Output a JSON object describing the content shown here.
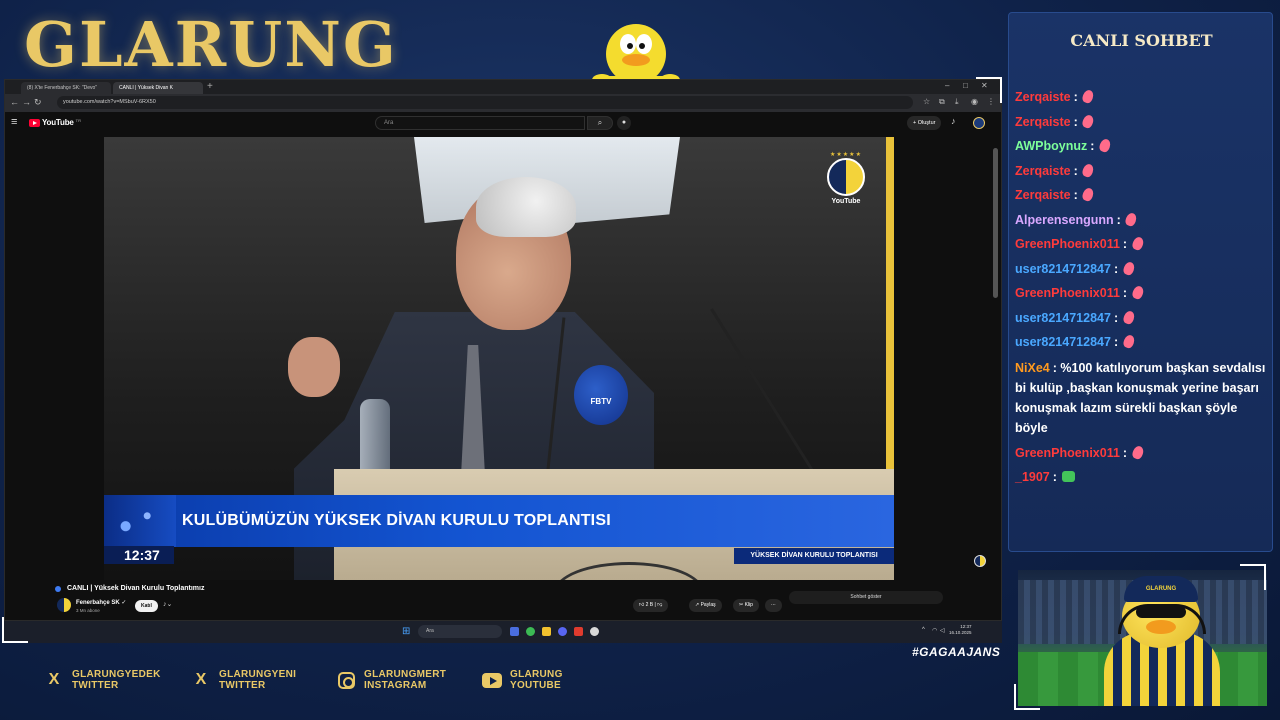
{
  "brand": {
    "name": "GLARUNG"
  },
  "browser": {
    "tabs": [
      {
        "label": "(8) X'te Fenerbahçe SK: \"Devo\""
      },
      {
        "label": "CANLI | Yüksek Divan K"
      }
    ],
    "url": "youtube.com/watch?v=MSbuV-6RX50"
  },
  "youtube": {
    "logo_text": "YouTube",
    "region": "TR",
    "search_placeholder": "Ara",
    "create_label": "Oluştur",
    "video": {
      "badge_text": "YouTube",
      "mic_label": "FBTV",
      "lower_third_title": "KULÜBÜMÜZÜN YÜKSEK DİVAN KURULU TOPLANTISI",
      "lower_third_time": "12:37",
      "lower_third_sub": "YÜKSEK DİVAN KURULU TOPLANTISI"
    },
    "title": "CANLI | Yüksek Divan Kurulu Toplantımız",
    "channel_name": "Fenerbahçe SK",
    "channel_subs": "3 Mn abone",
    "join_label": "Katıl",
    "likes": "2 B",
    "share_label": "Paylaş",
    "clip_label": "Klip",
    "show_chat_label": "Sohbet göster"
  },
  "taskbar": {
    "search_placeholder": "Ara",
    "time": "12:37",
    "date": "16.10.2025"
  },
  "chat": {
    "header": "CANLI SOHBET",
    "messages": [
      {
        "user": "Zerqaiste",
        "color": "#ff3b3b",
        "text": "",
        "emote": "pink"
      },
      {
        "user": "Zerqaiste",
        "color": "#ff3b3b",
        "text": "",
        "emote": "pink"
      },
      {
        "user": "AWPboynuz",
        "color": "#7dff9a",
        "text": "",
        "emote": "pink"
      },
      {
        "user": "Zerqaiste",
        "color": "#ff3b3b",
        "text": "",
        "emote": "pink"
      },
      {
        "user": "Zerqaiste",
        "color": "#ff3b3b",
        "text": "",
        "emote": "pink"
      },
      {
        "user": "Alperensengunn",
        "color": "#d9a8ff",
        "text": "",
        "emote": "pink"
      },
      {
        "user": "GreenPhoenix011",
        "color": "#ff3b3b",
        "text": "",
        "emote": "pink"
      },
      {
        "user": "user8214712847",
        "color": "#4aa8ff",
        "text": "",
        "emote": "pink"
      },
      {
        "user": "GreenPhoenix011",
        "color": "#ff3b3b",
        "text": "",
        "emote": "pink"
      },
      {
        "user": "user8214712847",
        "color": "#4aa8ff",
        "text": "",
        "emote": "pink"
      },
      {
        "user": "user8214712847",
        "color": "#4aa8ff",
        "text": "",
        "emote": "pink"
      },
      {
        "user": "NiXe4",
        "color": "#ff9a1f",
        "text": "%100 katılıyorum başkan sevdalısı bi kulüp ,başkan konuşmak yerine başarı konuşmak lazım sürekli başkan şöyle böyle",
        "emote": ""
      },
      {
        "user": "GreenPhoenix011",
        "color": "#ff3b3b",
        "text": "",
        "emote": "pink"
      },
      {
        "user": "_1907",
        "color": "#ff3b3b",
        "text": "",
        "emote": "green"
      }
    ]
  },
  "webcam": {
    "cap_text": "GLARUNG"
  },
  "hashtag": "#GAGAAJANS",
  "socials": [
    {
      "icon": "x-icon",
      "line1": "GLARUNGYEDEK",
      "line2": "TWITTER"
    },
    {
      "icon": "x-icon",
      "line1": "GLARUNGYENI",
      "line2": "TWITTER"
    },
    {
      "icon": "instagram-icon",
      "line1": "GLARUNGMERT",
      "line2": "INSTAGRAM"
    },
    {
      "icon": "youtube-icon",
      "line1": "GLARUNG",
      "line2": "YOUTUBE"
    }
  ],
  "colors": {
    "gold": "#e9c866",
    "navy": "#0f2249",
    "fb_yellow": "#f3d33a",
    "fb_navy": "#13295a"
  }
}
